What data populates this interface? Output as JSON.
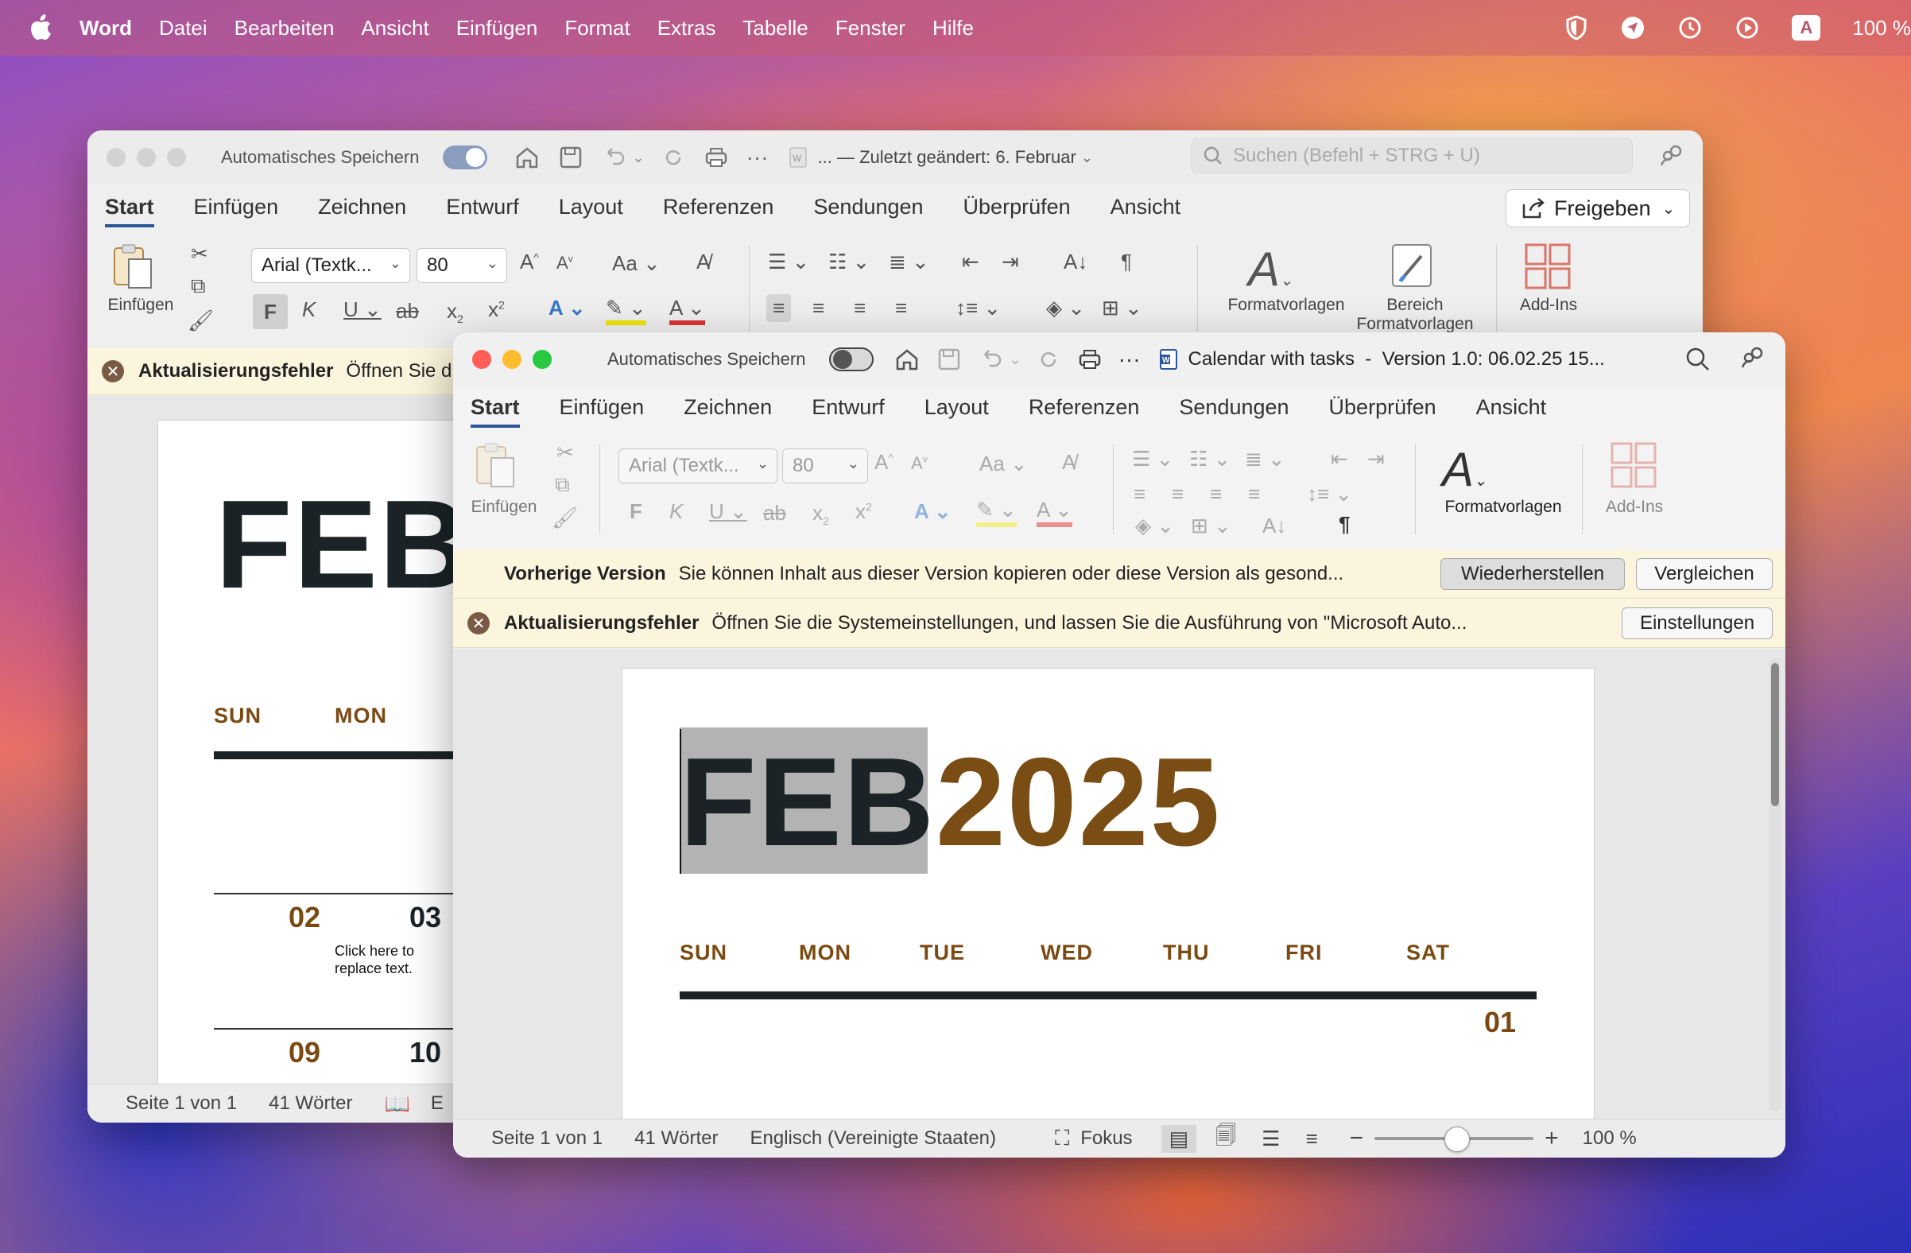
{
  "menubar": {
    "app": "Word",
    "items": [
      "Datei",
      "Bearbeiten",
      "Ansicht",
      "Einfügen",
      "Format",
      "Extras",
      "Tabelle",
      "Fenster",
      "Hilfe"
    ],
    "input_badge": "A",
    "battery": "100 %"
  },
  "back_window": {
    "autosave": "Automatisches Speichern",
    "doc_title": "... — Zuletzt geändert: 6. Februar",
    "search_placeholder": "Suchen (Befehl + STRG + U)",
    "tabs": [
      "Start",
      "Einfügen",
      "Zeichnen",
      "Entwurf",
      "Layout",
      "Referenzen",
      "Sendungen",
      "Überprüfen",
      "Ansicht"
    ],
    "share": "Freigeben",
    "font": "Arial (Textk...",
    "size": "80",
    "paste_label": "Einfügen",
    "styles_label": "Formatvorlagen",
    "styles_pane_label": "Bereich Formatvorlagen",
    "addins_label": "Add-Ins",
    "error_title": "Aktualisierungsfehler",
    "error_text": "Öffnen Sie d",
    "doc_heading": "FEB",
    "days": [
      "SUN",
      "MON"
    ],
    "dates_row1": [
      "02",
      "03"
    ],
    "placeholder_text": "Click here to replace text.",
    "dates_row2": [
      "09",
      "10"
    ],
    "status_page": "Seite 1 von 1",
    "status_words": "41 Wörter",
    "status_lang": "E"
  },
  "front_window": {
    "autosave": "Automatisches Speichern",
    "doc_title": "Calendar with tasks  -  Version 1.0: 06.02.25 15...",
    "tabs": [
      "Start",
      "Einfügen",
      "Zeichnen",
      "Entwurf",
      "Layout",
      "Referenzen",
      "Sendungen",
      "Überprüfen",
      "Ansicht"
    ],
    "font": "Arial (Textk...",
    "size": "80",
    "paste_label": "Einfügen",
    "styles_label": "Formatvorlagen",
    "addins_label": "Add-Ins",
    "prev_version_title": "Vorherige Version",
    "prev_version_text": "Sie können Inhalt aus dieser Version kopieren oder diese Version als gesond...",
    "restore_btn": "Wiederherstellen",
    "compare_btn": "Vergleichen",
    "error_title": "Aktualisierungsfehler",
    "error_text": "Öffnen Sie die Systemeinstellungen, und lassen Sie die Ausführung von \"Microsoft Auto...",
    "settings_btn": "Einstellungen",
    "doc_month": "FEB",
    "doc_year": "2025",
    "days": [
      "SUN",
      "MON",
      "TUE",
      "WED",
      "THU",
      "FRI",
      "SAT"
    ],
    "first_date": "01",
    "status_page": "Seite 1 von 1",
    "status_words": "41 Wörter",
    "status_lang": "Englisch (Vereinigte Staaten)",
    "focus": "Fokus",
    "zoom": "100 %"
  },
  "colors": {
    "accent": "#2b579a",
    "date_brown": "#7a4a12",
    "heading_dark": "#1b2326",
    "year_brown": "#7a4d14",
    "selection": "#b3b3b3",
    "yellow_bar": "#fcf5dd"
  }
}
